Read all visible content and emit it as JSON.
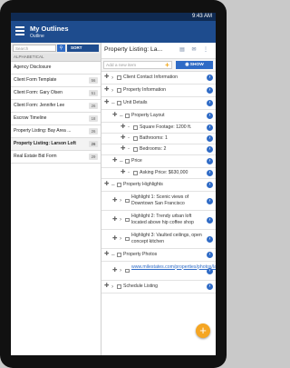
{
  "status_bar": {
    "time": "9:43 AM"
  },
  "app": {
    "title": "My Outlines",
    "subtitle": "Outline"
  },
  "search": {
    "placeholder": "Search",
    "sort_label": "SORT"
  },
  "list": {
    "section_header": "ALPHABETICAL",
    "items": [
      {
        "name": "Agency Disclosure",
        "count": ""
      },
      {
        "name": "Client Form Template",
        "count": "56"
      },
      {
        "name": "Client Form: Gary Olsen",
        "count": "51"
      },
      {
        "name": "Client Form: Jennifer Lee",
        "count": "26"
      },
      {
        "name": "Escrow Timeline",
        "count": "18"
      },
      {
        "name": "Property Listing: Bay Area ...",
        "count": "26"
      },
      {
        "name": "Property Listing: Larson Loft",
        "count": "26"
      },
      {
        "name": "Real Estate Bid Form",
        "count": "29"
      }
    ],
    "selected_index": 6
  },
  "detail": {
    "title": "Property Listing: La...",
    "new_item_placeholder": "Add a new item",
    "show_label": "SHOW",
    "rows": [
      {
        "level": 0,
        "text": "Client Contact Information"
      },
      {
        "level": 0,
        "text": "Property Information"
      },
      {
        "level": 0,
        "text": "Unit Details"
      },
      {
        "level": 1,
        "text": "Property Layout"
      },
      {
        "level": 2,
        "text": "Square Footage: 1200 ft."
      },
      {
        "level": 2,
        "text": "Bathrooms: 1"
      },
      {
        "level": 2,
        "text": "Bedrooms: 2"
      },
      {
        "level": 1,
        "text": "Price"
      },
      {
        "level": 2,
        "text": "Asking Price: $630,000"
      },
      {
        "level": 0,
        "text": "Property Highlights"
      },
      {
        "level": 1,
        "text": "Highlight 1: Scenic views of Downtown San Francisco"
      },
      {
        "level": 1,
        "text": "Highlight 2: Trendy urban loft located above hip coffee shop"
      },
      {
        "level": 1,
        "text": "Highlight 3: Vaulted ceilings, open concept kitchen"
      },
      {
        "level": 0,
        "text": "Property Photos"
      },
      {
        "level": 1,
        "text": "www.milestates.com/properties/photos/larson/loft"
      },
      {
        "level": 0,
        "text": "Schedule Listing"
      }
    ]
  },
  "colors": {
    "appbar": "#1e4c8e",
    "accent": "#2f6bc6",
    "fab": "#f5a623"
  },
  "fab_icon": "plus-icon"
}
